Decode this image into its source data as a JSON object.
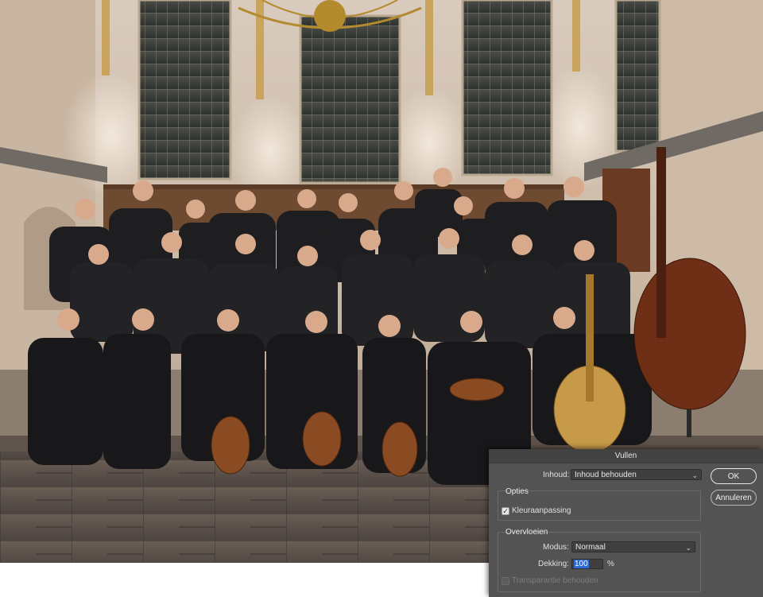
{
  "dialog": {
    "title": "Vullen",
    "contents": {
      "label": "Inhoud:",
      "value": "Inhoud behouden"
    },
    "buttons": {
      "ok": "OK",
      "cancel": "Annuleren"
    },
    "options": {
      "title": "Opties",
      "color_adaptation": {
        "label": "Kleuraanpassing",
        "checked": true
      }
    },
    "blending": {
      "title": "Overvloeien",
      "mode": {
        "label": "Modus:",
        "value": "Normaal"
      },
      "opacity": {
        "label": "Dekking:",
        "value": "100",
        "unit": "%"
      },
      "preserve_transparency": {
        "label": "Transparantie behouden",
        "checked": false,
        "enabled": false
      }
    }
  },
  "colors": {
    "dialog_bg": "#535353",
    "titlebar_bg": "#424242",
    "field_bg": "#3f3f3f",
    "selection": "#2d6ad1"
  },
  "icons": {
    "select_chevron": "chevron-updown-icon",
    "checkbox_check": "checkmark-icon"
  }
}
